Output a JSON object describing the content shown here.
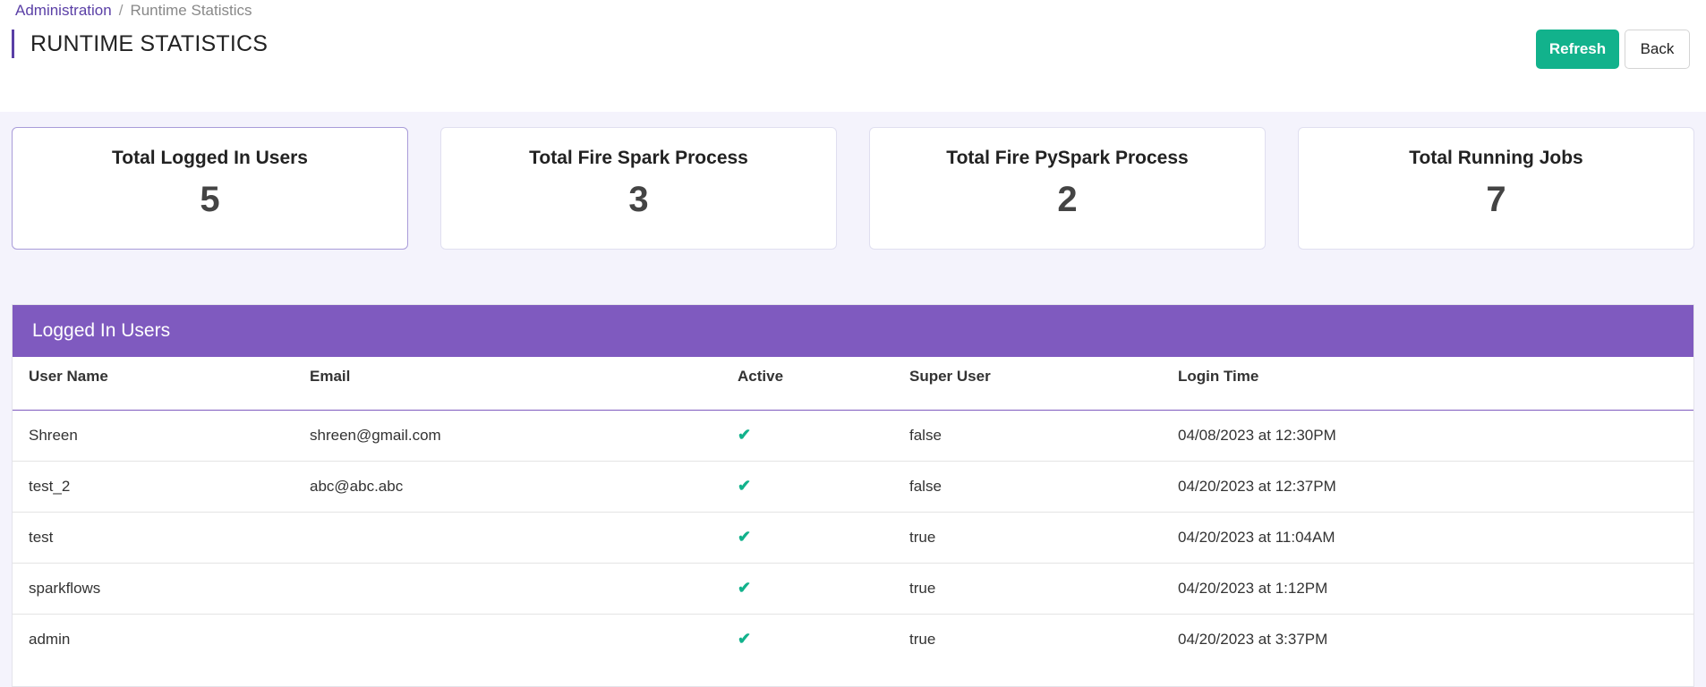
{
  "breadcrumb": {
    "parent": "Administration",
    "separator": "/",
    "current": "Runtime Statistics"
  },
  "page": {
    "title": "RUNTIME STATISTICS"
  },
  "actions": {
    "refresh_label": "Refresh",
    "back_label": "Back"
  },
  "stats": [
    {
      "label": "Total Logged In Users",
      "value": "5"
    },
    {
      "label": "Total Fire Spark Process",
      "value": "3"
    },
    {
      "label": "Total Fire PySpark Process",
      "value": "2"
    },
    {
      "label": "Total Running Jobs",
      "value": "7"
    }
  ],
  "users_panel": {
    "title": "Logged In Users",
    "columns": [
      "User Name",
      "Email",
      "Active",
      "Super User",
      "Login Time"
    ],
    "rows": [
      {
        "name": "Shreen",
        "email": "shreen@gmail.com",
        "active": "✔",
        "super_user": "false",
        "login_time": "04/08/2023 at 12:30PM"
      },
      {
        "name": "test_2",
        "email": "abc@abc.abc",
        "active": "✔",
        "super_user": "false",
        "login_time": "04/20/2023 at 12:37PM"
      },
      {
        "name": "test",
        "email": "",
        "active": "✔",
        "super_user": "true",
        "login_time": "04/20/2023 at 11:04AM"
      },
      {
        "name": "sparkflows",
        "email": "",
        "active": "✔",
        "super_user": "true",
        "login_time": "04/20/2023 at 1:12PM"
      },
      {
        "name": "admin",
        "email": "",
        "active": "✔",
        "super_user": "true",
        "login_time": "04/20/2023 at 3:37PM"
      }
    ]
  },
  "icons": {
    "active_check": "check-icon"
  },
  "colors": {
    "accent": "#7f5abf",
    "brand": "#5a3fa6",
    "success": "#12b28c",
    "background": "#f4f3fc"
  }
}
